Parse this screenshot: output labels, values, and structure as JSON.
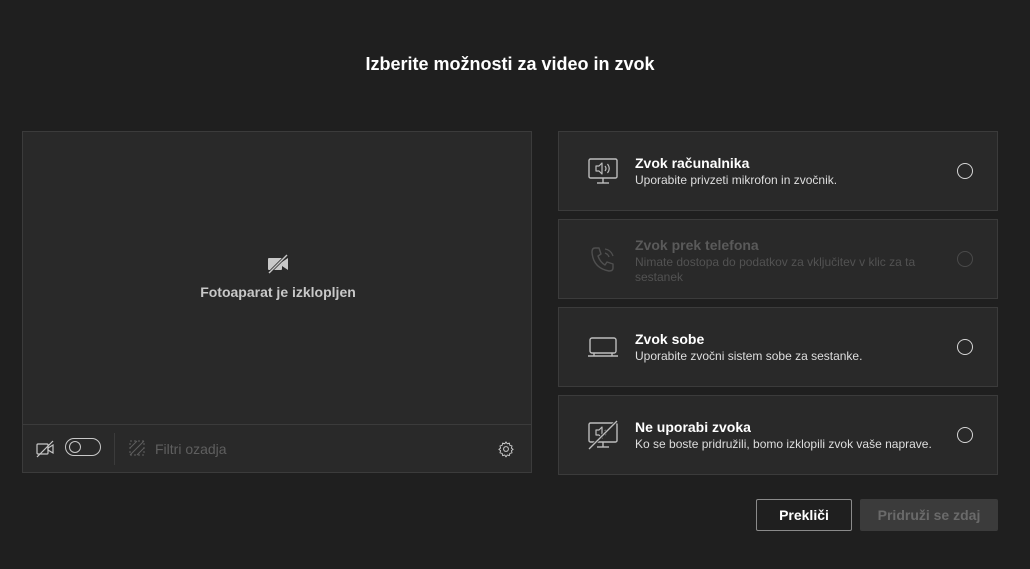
{
  "title": "Izberite možnosti za video in zvok",
  "preview": {
    "camera_off_text": "Fotoaparat je izklopljen",
    "camera_toggle_on": false,
    "background_filters_label": "Filtri ozadja"
  },
  "options": [
    {
      "title": "Zvok računalnika",
      "description": "Uporabite privzeti mikrofon in zvočnik.",
      "icon": "computer-audio-icon",
      "enabled": true
    },
    {
      "title": "Zvok prek telefona",
      "description": "Nimate dostopa do podatkov za vključitev v klic za ta sestanek",
      "icon": "phone-audio-icon",
      "enabled": false
    },
    {
      "title": "Zvok sobe",
      "description": "Uporabite zvočni sistem sobe za sestanke.",
      "icon": "room-audio-icon",
      "enabled": true
    },
    {
      "title": "Ne uporabi zvoka",
      "description": "Ko se boste pridružili, bomo izklopili zvok vaše naprave.",
      "icon": "no-audio-icon",
      "enabled": true
    }
  ],
  "buttons": {
    "cancel": "Prekliči",
    "join": "Pridruži se zdaj"
  }
}
